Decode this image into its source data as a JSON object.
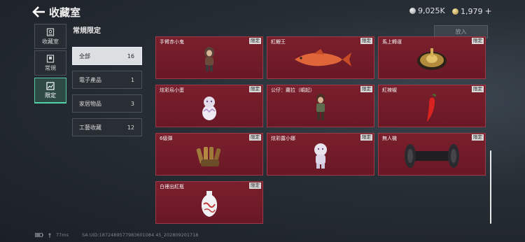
{
  "header": {
    "title": "收藏室",
    "currency1": "9,025K",
    "currency2": "1,979",
    "plus": "+"
  },
  "left_tabs": [
    {
      "label": "收藏室"
    },
    {
      "label": "常規"
    },
    {
      "label": "限定"
    }
  ],
  "section_title": "常規限定",
  "categories": [
    {
      "label": "全部",
      "count": "16"
    },
    {
      "label": "電子產品",
      "count": "1"
    },
    {
      "label": "家居物品",
      "count": "3"
    },
    {
      "label": "工藝收藏",
      "count": "12"
    }
  ],
  "put_button": "放入",
  "tag": "限定",
  "items": [
    {
      "name": "手臂赤小鬼"
    },
    {
      "name": "紅鯉王"
    },
    {
      "name": "馬上轉運"
    },
    {
      "name": "炫彩烏小蛋"
    },
    {
      "name": "公仔：蘿拉（崛起）"
    },
    {
      "name": "紅辣椒"
    },
    {
      "name": "6級彈"
    },
    {
      "name": "炫彩露小娜"
    },
    {
      "name": "無人機"
    },
    {
      "name": "白裡出紅瓶"
    }
  ],
  "footer": {
    "ping": "77ms",
    "uid": "SA UID:1872489577983601084 45_202809201718"
  }
}
